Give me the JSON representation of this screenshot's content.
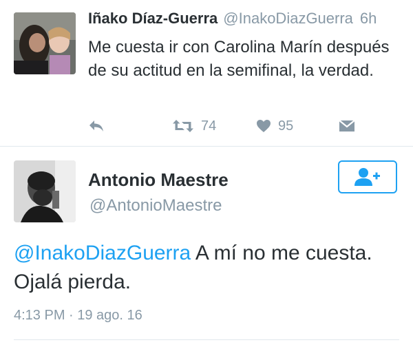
{
  "tweet1": {
    "name": "Iñako Díaz-Guerra",
    "handle": "@InakoDiazGuerra",
    "time": "6h",
    "text": "Me cuesta ir con Carolina Marín después de su actitud en la semifinal, la verdad.",
    "actions": {
      "reply_icon": "reply-icon",
      "retweet_icon": "retweet-icon",
      "retweet_count": "74",
      "like_icon": "heart-icon",
      "like_count": "95",
      "dm_icon": "direct-message-icon"
    }
  },
  "tweet2": {
    "name": "Antonio Maestre",
    "handle": "@AntonioMaestre",
    "follow_icon": "follow-user-icon",
    "mention": "@InakoDiazGuerra",
    "text": " A mí no me cuesta. Ojalá pierda.",
    "timestamp": "4:13 PM · 19 ago. 16"
  },
  "colors": {
    "accent": "#1da1f2",
    "text": "#292f33",
    "muted": "#8899a6",
    "divider": "#e1e8ed"
  }
}
